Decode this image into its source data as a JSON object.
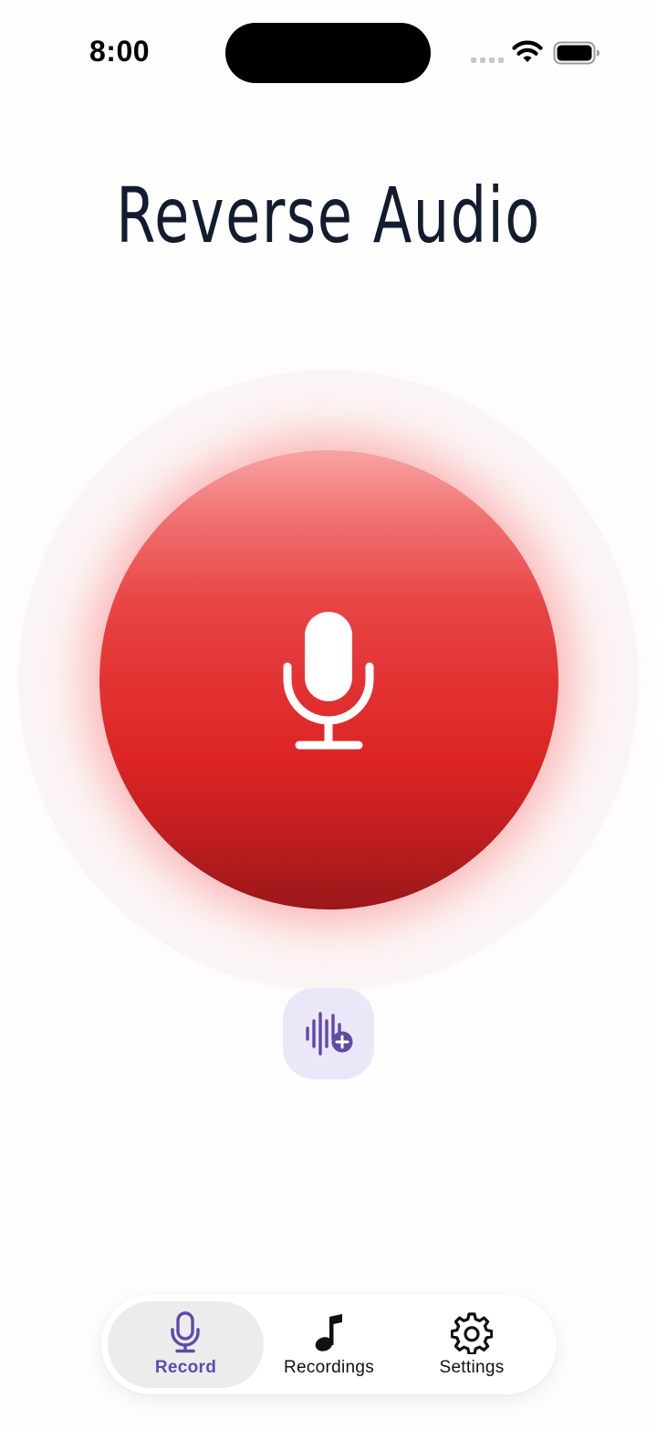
{
  "status_bar": {
    "time": "8:00"
  },
  "header": {
    "title": "Reverse Audio"
  },
  "record": {
    "button_icon": "microphone-icon",
    "color_top": "#f9a3a3",
    "color_mid": "#dc2424",
    "color_bottom": "#9a1719"
  },
  "add_audio": {
    "icon": "waveform-plus-icon",
    "accent": "#5f4aa8"
  },
  "tab_bar": {
    "tabs": [
      {
        "label": "Record",
        "icon": "microphone-icon",
        "active": true
      },
      {
        "label": "Recordings",
        "icon": "music-note-icon",
        "active": false
      },
      {
        "label": "Settings",
        "icon": "gear-icon",
        "active": false
      }
    ],
    "active_color": "#5f4aa8",
    "inactive_color": "#111111"
  }
}
